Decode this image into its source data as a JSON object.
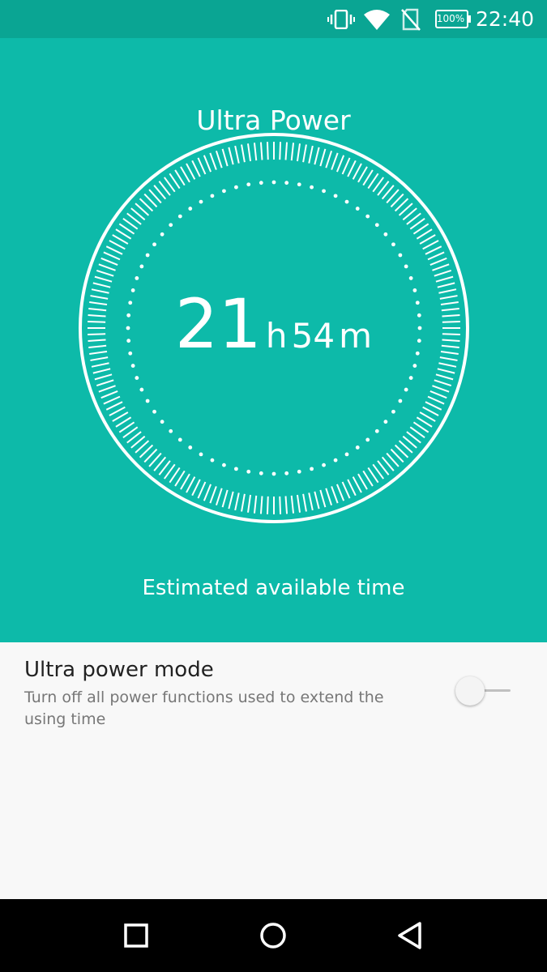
{
  "status_bar": {
    "time": "22:40",
    "battery_percent": "100%",
    "icons": [
      "vibrate-icon",
      "wifi-icon",
      "no-sim-icon",
      "battery-icon"
    ],
    "background": "#0aa593"
  },
  "header": {
    "title": "Ultra Power",
    "background": "#0dbaa9"
  },
  "gauge": {
    "hours": "21",
    "hours_unit": "h",
    "minutes": "54",
    "minutes_unit": "m",
    "caption": "Estimated available time"
  },
  "settings": {
    "ultra_power_mode": {
      "title": "Ultra power mode",
      "description": "Turn off all power functions used to extend the using time",
      "enabled": false
    }
  },
  "nav_bar": {
    "buttons": [
      "recents-button",
      "home-button",
      "back-button"
    ]
  }
}
